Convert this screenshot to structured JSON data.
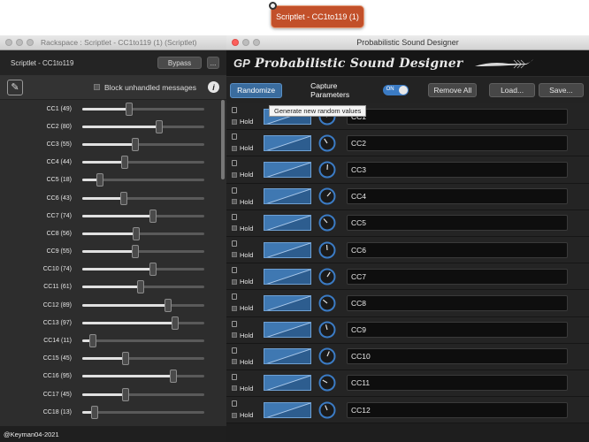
{
  "node": {
    "title": "Scriptlet - CC1to119 (1)"
  },
  "left_window": {
    "title": "Rackspace : Scriptlet - CC1to119 (1) (Scriptlet)",
    "header_label": "Scriptlet - CC1to119",
    "bypass_label": "Bypass",
    "more_label": "...",
    "block_label": "Block unhandled messages",
    "info_label": "i",
    "sliders": [
      {
        "label": "CC1 (49)",
        "value": 49
      },
      {
        "label": "CC2 (80)",
        "value": 80
      },
      {
        "label": "CC3 (55)",
        "value": 55
      },
      {
        "label": "CC4 (44)",
        "value": 44
      },
      {
        "label": "CC5 (18)",
        "value": 18
      },
      {
        "label": "CC6 (43)",
        "value": 43
      },
      {
        "label": "CC7 (74)",
        "value": 74
      },
      {
        "label": "CC8 (56)",
        "value": 56
      },
      {
        "label": "CC9 (55)",
        "value": 55
      },
      {
        "label": "CC10 (74)",
        "value": 74
      },
      {
        "label": "CC11 (61)",
        "value": 61
      },
      {
        "label": "CC12 (89)",
        "value": 89
      },
      {
        "label": "CC13 (97)",
        "value": 97
      },
      {
        "label": "CC14 (11)",
        "value": 11
      },
      {
        "label": "CC15 (45)",
        "value": 45
      },
      {
        "label": "CC16 (95)",
        "value": 95
      },
      {
        "label": "CC17 (45)",
        "value": 45
      },
      {
        "label": "CC18 (13)",
        "value": 13
      }
    ],
    "footer": "@Keyman04-2021"
  },
  "right_window": {
    "title": "Probabilistic Sound Designer",
    "banner_title": "Probabilistic Sound Designer",
    "logo_text": "GP",
    "randomize_label": "Randomize",
    "tooltip": "Generate new random values",
    "capture_label": "Capture Parameters",
    "toggle_label": "ON",
    "remove_all_label": "Remove All",
    "load_label": "Load...",
    "save_label": "Save...",
    "hold_label": "Hold",
    "rows": [
      "CC1",
      "CC2",
      "CC3",
      "CC4",
      "CC5",
      "CC6",
      "CC7",
      "CC8",
      "CC9",
      "CC10",
      "CC11",
      "CC12"
    ]
  },
  "colors": {
    "accent": "#3f78b2",
    "node": "#c2502a",
    "toggle": "#3b7bc4"
  },
  "icons": [
    "edit-icon",
    "info-icon",
    "lock-icon",
    "feather-icon",
    "dial-icon"
  ]
}
